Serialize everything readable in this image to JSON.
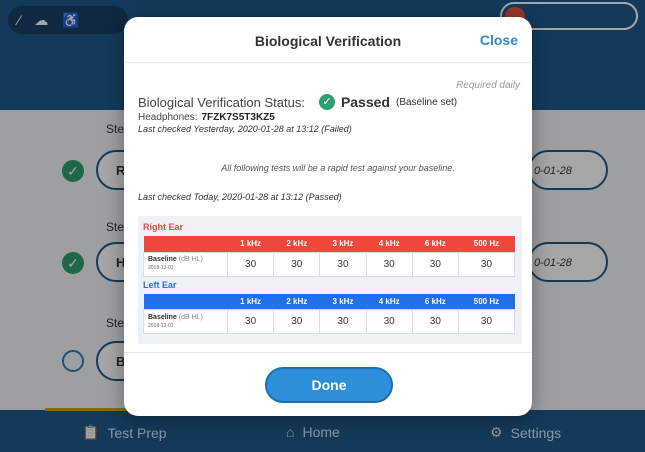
{
  "background": {
    "steps": [
      "Step",
      "Step",
      "Step"
    ],
    "pill_letters": [
      "R",
      "H",
      "B"
    ],
    "pill_dates": [
      "0-01-28",
      "0-01-28"
    ],
    "nav": {
      "test_prep": "Test Prep",
      "home": "Home",
      "settings": "Settings"
    }
  },
  "modal": {
    "title": "Biological Verification",
    "close": "Close",
    "required": "Required daily",
    "status_label": "Biological Verification Status:",
    "status_value": "Passed",
    "status_note": "(Baseline set)",
    "headphones_label": "Headphones:",
    "headphones_value": "7FZK7S5T3KZ5",
    "last_checked_1": "Last checked Yesterday, 2020-01-28 at 13:12 (Failed)",
    "rapid_note": "All following tests will be a rapid test against your baseline.",
    "last_checked_2": "Last checked Today, 2020-01-28 at 13:12 (Passed)",
    "right_ear_label": "Right Ear",
    "left_ear_label": "Left Ear",
    "frequencies": [
      "1 kHz",
      "2 kHz",
      "3 kHz",
      "4 kHz",
      "6 kHz",
      "500 Hz"
    ],
    "row_label": "Baseline",
    "row_unit": "(dB HL)",
    "row_date": "2018-12-01",
    "right_values": [
      "30",
      "30",
      "30",
      "30",
      "30",
      "30"
    ],
    "left_values": [
      "30",
      "30",
      "30",
      "30",
      "30",
      "30"
    ],
    "done": "Done"
  },
  "colors": {
    "brand": "#1e5a8c",
    "right_ear": "#f0473b",
    "left_ear": "#2070ea",
    "passed": "#2ea06d",
    "primary_button": "#2d8fda"
  }
}
